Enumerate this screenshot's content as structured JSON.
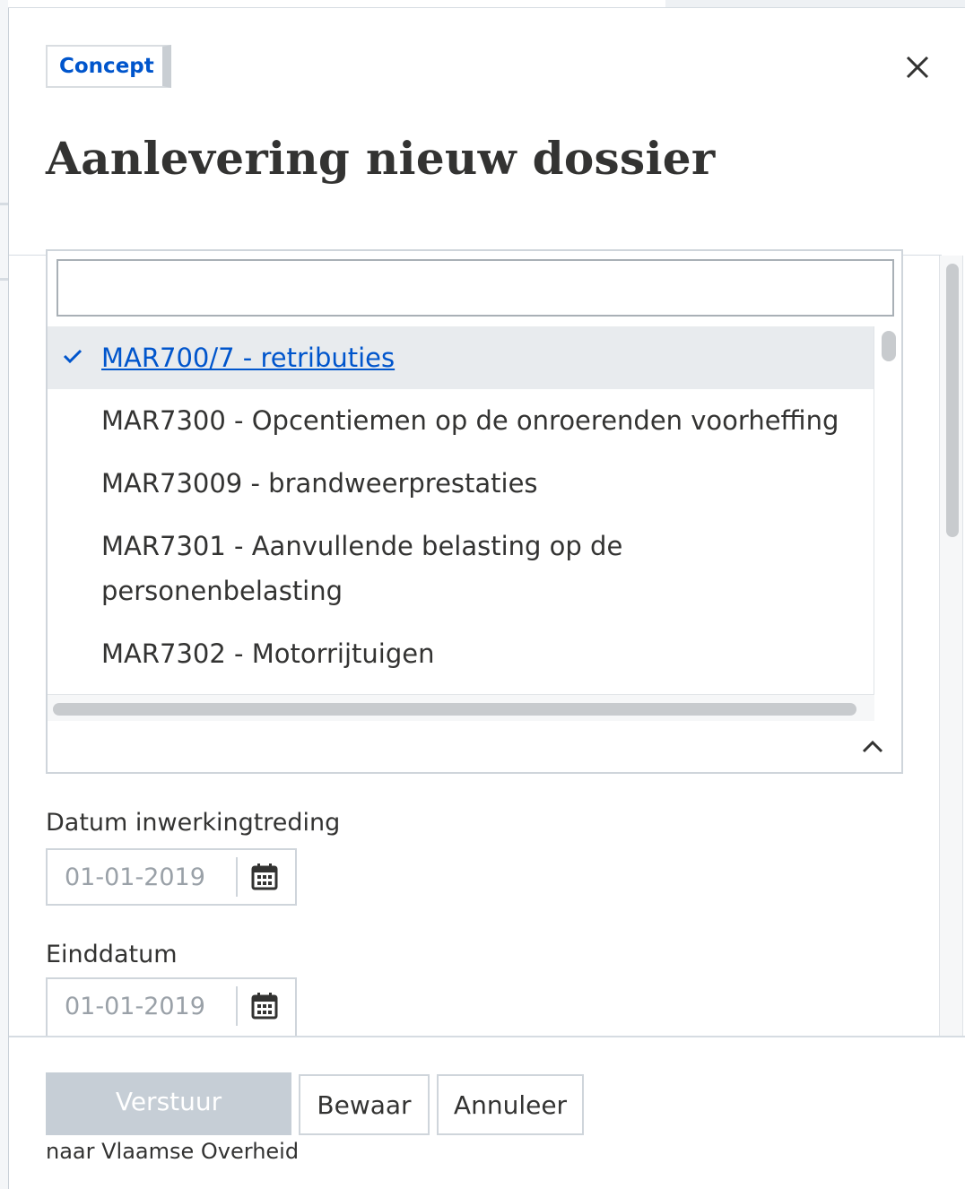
{
  "badge": {
    "label": "Concept"
  },
  "modal": {
    "title": "Aanlevering nieuw dossier"
  },
  "select": {
    "search_value": "",
    "options": [
      {
        "label": "MAR700/7 - retributies",
        "selected": true
      },
      {
        "label": "MAR7300 - Opcentiemen op de onroerenden voorheffing",
        "selected": false
      },
      {
        "label": "MAR73009 - brandweerprestaties",
        "selected": false
      },
      {
        "label": "MAR7301 - Aanvullende belasting op de personenbelasting",
        "selected": false
      },
      {
        "label": "MAR7302 - Motorrijtuigen",
        "selected": false
      }
    ]
  },
  "fields": {
    "start_date": {
      "label": "Datum inwerkingtreding",
      "placeholder": "01-01-2019"
    },
    "end_date": {
      "label": "Einddatum",
      "placeholder": "01-01-2019"
    }
  },
  "footer": {
    "submit_label": "Verstuur",
    "submit_note": "naar Vlaamse Overheid",
    "save_label": "Bewaar",
    "cancel_label": "Annuleer"
  },
  "icons": {
    "close": "close-icon",
    "check": "check-icon",
    "chevron": "chevron-up-icon",
    "calendar": "calendar-icon"
  },
  "colors": {
    "accent": "#0055cc",
    "text": "#333332",
    "disabled_button": "#c6ced6",
    "selected_bg": "#e8ebee"
  }
}
